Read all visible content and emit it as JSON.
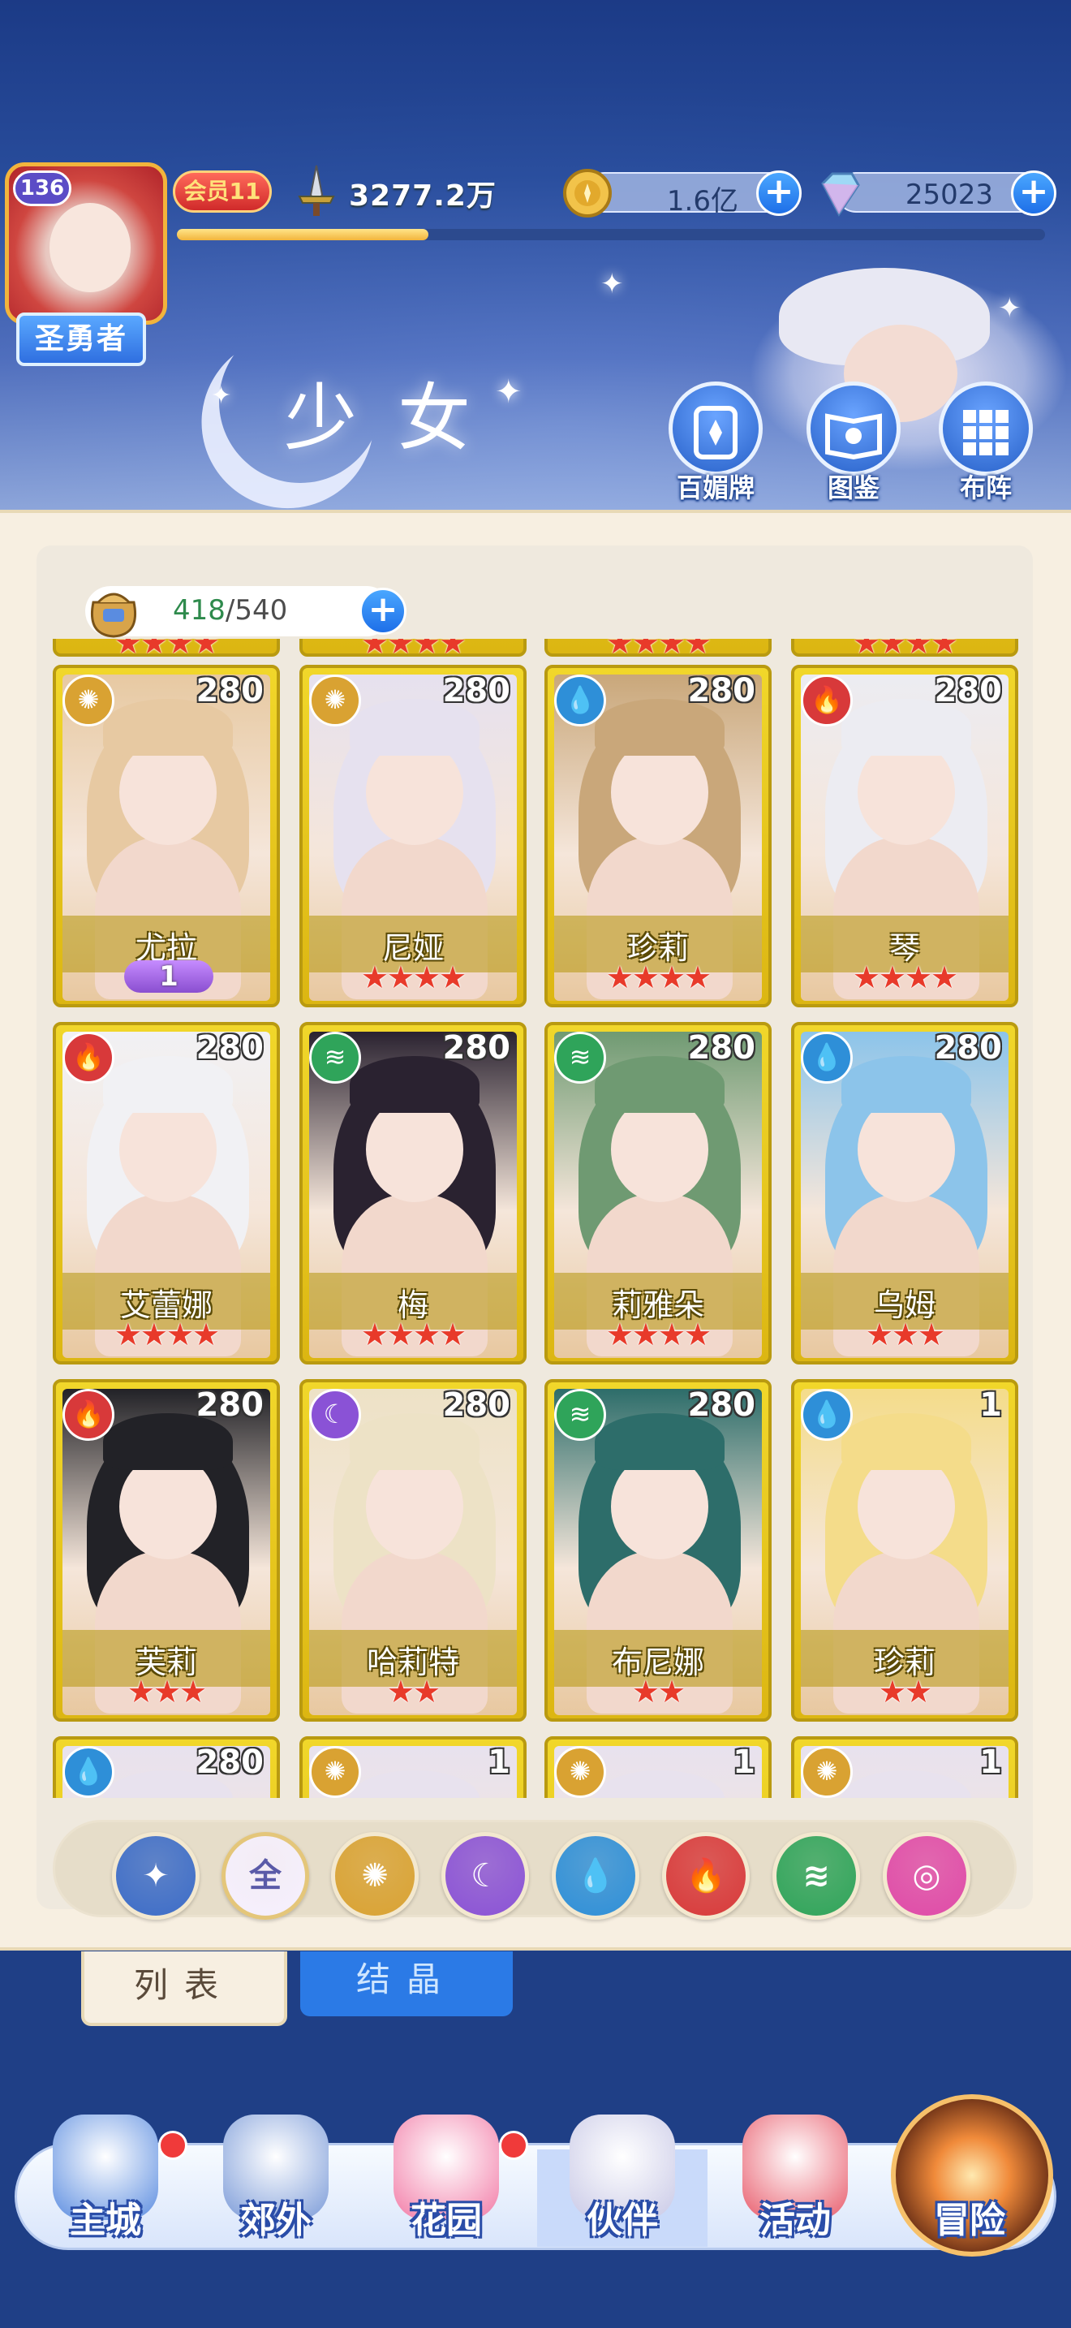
{
  "header": {
    "player_level": "136",
    "player_title": "圣勇者",
    "vip": "会员11",
    "power": "3277.2万",
    "gold": "1.6亿",
    "diamonds": "25023",
    "xp_fraction": 0.29,
    "page_title": "少女",
    "buttons": [
      {
        "label": "百媚牌",
        "icon": "card-icon"
      },
      {
        "label": "图鉴",
        "icon": "book-icon"
      },
      {
        "label": "布阵",
        "icon": "grid-icon"
      }
    ]
  },
  "inventory": {
    "owned": "418",
    "sep": "/",
    "capacity": "540"
  },
  "cards": [
    {
      "name": "尤拉",
      "level": "280",
      "element": "light",
      "stars": 0,
      "badge": "1",
      "hair": "#e7c9a2"
    },
    {
      "name": "尼娅",
      "level": "280",
      "element": "light",
      "stars": 4,
      "hair": "#e6e1ef"
    },
    {
      "name": "珍莉",
      "level": "280",
      "element": "water",
      "stars": 4,
      "hair": "#c9a77a"
    },
    {
      "name": "琴",
      "level": "280",
      "element": "fire",
      "stars": 4,
      "hair": "#ececf2"
    },
    {
      "name": "艾蕾娜",
      "level": "280",
      "element": "fire",
      "stars": 4,
      "hair": "#f1f1f4"
    },
    {
      "name": "梅",
      "level": "280",
      "element": "wind",
      "stars": 4,
      "hair": "#2a2230"
    },
    {
      "name": "莉雅朵",
      "level": "280",
      "element": "wind",
      "stars": 4,
      "hair": "#6f9a72"
    },
    {
      "name": "乌姆",
      "level": "280",
      "element": "water",
      "stars": 3,
      "hair": "#8cc4ea"
    },
    {
      "name": "芙莉",
      "level": "280",
      "element": "fire",
      "stars": 3,
      "hair": "#222227"
    },
    {
      "name": "哈莉特",
      "level": "280",
      "element": "dark",
      "stars": 2,
      "hair": "#ede2c6"
    },
    {
      "name": "布尼娜",
      "level": "280",
      "element": "wind",
      "stars": 2,
      "hair": "#2d6d6a"
    },
    {
      "name": "珍莉",
      "level": "1",
      "element": "water",
      "stars": 2,
      "hair": "#f4dc8a"
    }
  ],
  "partial_cards": [
    {
      "level": "280",
      "element": "water"
    },
    {
      "level": "1",
      "element": "light"
    },
    {
      "level": "1",
      "element": "light"
    },
    {
      "level": "1",
      "element": "light"
    }
  ],
  "element_filters": [
    {
      "id": "star",
      "label": "",
      "icon": "sparkle-icon"
    },
    {
      "id": "all",
      "label": "全",
      "icon": "all-icon"
    },
    {
      "id": "light",
      "label": "",
      "icon": "sun-icon"
    },
    {
      "id": "dark",
      "label": "",
      "icon": "moon-icon"
    },
    {
      "id": "water",
      "label": "",
      "icon": "water-drop-icon"
    },
    {
      "id": "fire",
      "label": "",
      "icon": "flame-icon"
    },
    {
      "id": "wind",
      "label": "",
      "icon": "whirlwind-icon"
    },
    {
      "id": "special",
      "label": "",
      "icon": "orbit-icon"
    }
  ],
  "tabs": {
    "list": "列表",
    "crystal": "结晶"
  },
  "nav": [
    {
      "label": "主城",
      "dot": true
    },
    {
      "label": "郊外",
      "dot": false
    },
    {
      "label": "花园",
      "dot": true
    },
    {
      "label": "伙伴",
      "dot": false,
      "active": true
    },
    {
      "label": "活动",
      "dot": false
    },
    {
      "label": "冒险",
      "dot": false
    }
  ],
  "colors": {
    "light": "#d9a232",
    "dark": "#8a52d6",
    "water": "#2e8fd8",
    "fire": "#d8393a",
    "wind": "#2fa45a",
    "special": "#e04aa8",
    "star": "#3c6cc8",
    "card_gold": "#e9cb1e"
  }
}
